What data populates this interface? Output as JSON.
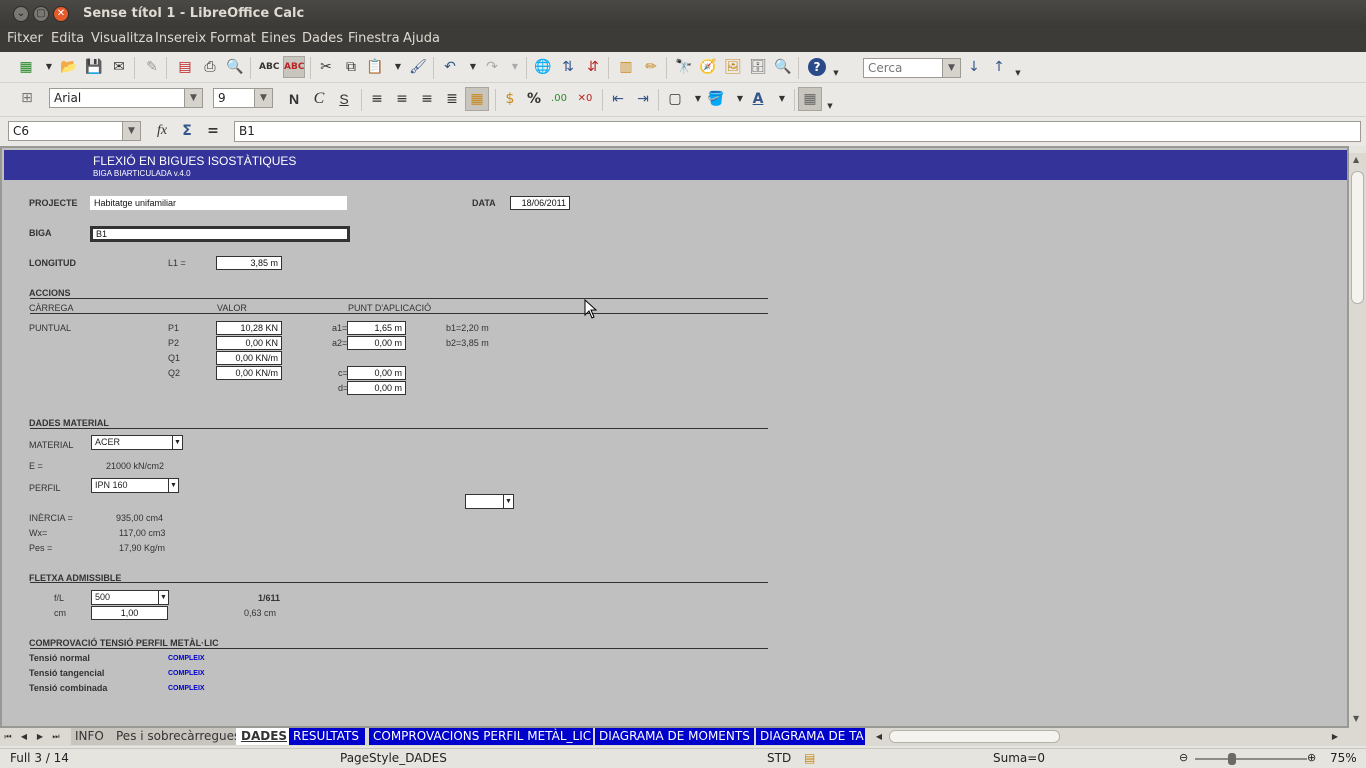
{
  "window": {
    "title": "Sense títol 1 - LibreOffice Calc"
  },
  "menu": [
    "Fitxer",
    "Edita",
    "Visualitza",
    "Insereix",
    "Format",
    "Eines",
    "Dades",
    "Finestra",
    "Ajuda"
  ],
  "toolbar": {
    "search_placeholder": "Cerca",
    "font_name": "Arial",
    "font_size": "9",
    "bold": "N",
    "italic": "C",
    "underline": "S",
    "percent": "%"
  },
  "formula": {
    "cell_ref": "C6",
    "content": "B1"
  },
  "sheet": {
    "title": "FLEXIÓ EN BIGUES ISOSTÀTIQUES",
    "subtitle": "BIGA BIARTICULADA v.4.0",
    "projecte_label": "PROJECTE",
    "projecte_value": "Habitatge unifamiliar",
    "data_label": "DATA",
    "data_value": "18/06/2011",
    "biga_label": "BIGA",
    "biga_value": "B1",
    "longitud_label": "LONGITUD",
    "l1_label": "L1 =",
    "l1_value": "3,85 m",
    "accions_heading": "ACCIONS",
    "col_carrega": "CÀRREGA",
    "col_valor": "VALOR",
    "col_punt": "PUNT D'APLICACIÓ",
    "puntual_label": "PUNTUAL",
    "p1_label": "P1",
    "p1_value": "10,28 KN",
    "a1_label": "a1=",
    "a1_value": "1,65 m",
    "b1_text": "b1=2,20 m",
    "p2_label": "P2",
    "p2_value": "0,00 KN",
    "a2_label": "a2=",
    "a2_value": "0,00 m",
    "b2_text": "b2=3,85 m",
    "q1_label": "Q1",
    "q1_value": "0,00 KN/m",
    "q2_label": "Q2",
    "q2_value": "0,00 KN/m",
    "c_label": "c=",
    "c_value": "0,00 m",
    "d_label": "d=",
    "d_value": "0,00 m",
    "material_heading": "DADES MATERIAL",
    "material_label": "MATERIAL",
    "material_value": "ACER",
    "e_label": "E =",
    "e_value": "21000 kN/cm2",
    "perfil_label": "PERFIL",
    "perfil_value": "IPN 160",
    "inercia_label": "INÈRCIA =",
    "inercia_value": "935,00 cm4",
    "wx_label": "Wx=",
    "wx_value": "117,00 cm3",
    "pes_label": "Pes =",
    "pes_value": "17,90 Kg/m",
    "fletxa_heading": "FLETXA ADMISSIBLE",
    "fl_label": "f/L",
    "fl_value": "500",
    "fl_result": "1/611",
    "cm_label": "cm",
    "cm_value": "1,00",
    "cm_result": "0,63 cm",
    "comprov_heading": "COMPROVACIÓ TENSIÓ PERFIL METÀL·LIC",
    "tensio_normal": "Tensió normal",
    "tensio_tangencial": "Tensió tangencial",
    "tensio_combinada": "Tensió combinada",
    "compleix": "COMPLEIX"
  },
  "tabs": [
    "INFO",
    "Pes i sobrecàrregues",
    "DADES",
    "RESULTATS",
    "COMPROVACIONS PERFIL METÀL_LIC",
    "DIAGRAMA DE MOMENTS",
    "DIAGRAMA DE TA"
  ],
  "status": {
    "sheet": "Full 3 / 14",
    "page_style": "PageStyle_DADES",
    "mode": "STD",
    "sum": "Suma=0",
    "zoom": "75%"
  },
  "colors": {
    "banner": "#333399",
    "compleix": "#0000cc",
    "tab_blue": "#0000cc"
  }
}
